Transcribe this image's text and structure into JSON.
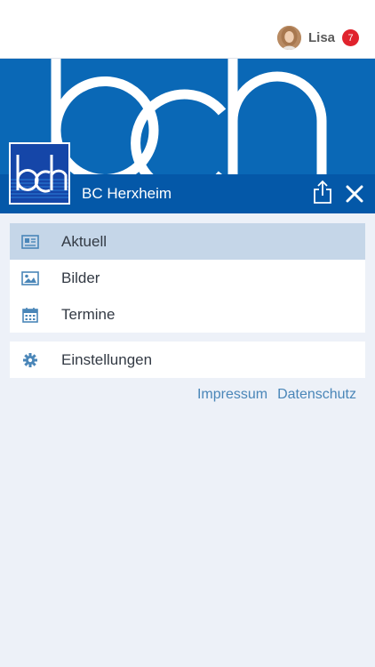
{
  "header": {
    "user_name": "Lisa",
    "notification_count": "7"
  },
  "club": {
    "name": "BC Herxheim"
  },
  "menu": {
    "items": [
      {
        "label": "Aktuell",
        "icon": "newspaper-icon",
        "active": true
      },
      {
        "label": "Bilder",
        "icon": "image-icon",
        "active": false
      },
      {
        "label": "Termine",
        "icon": "calendar-icon",
        "active": false
      }
    ],
    "settings": {
      "label": "Einstellungen",
      "icon": "gear-icon"
    }
  },
  "footer_links": {
    "impressum": "Impressum",
    "datenschutz": "Datenschutz"
  },
  "colors": {
    "banner": "#0a68b6",
    "clubbar": "#0458a8",
    "active_item": "#c5d6e8",
    "badge": "#e0232d",
    "link": "#4a86b8",
    "background": "#edf1f8"
  }
}
